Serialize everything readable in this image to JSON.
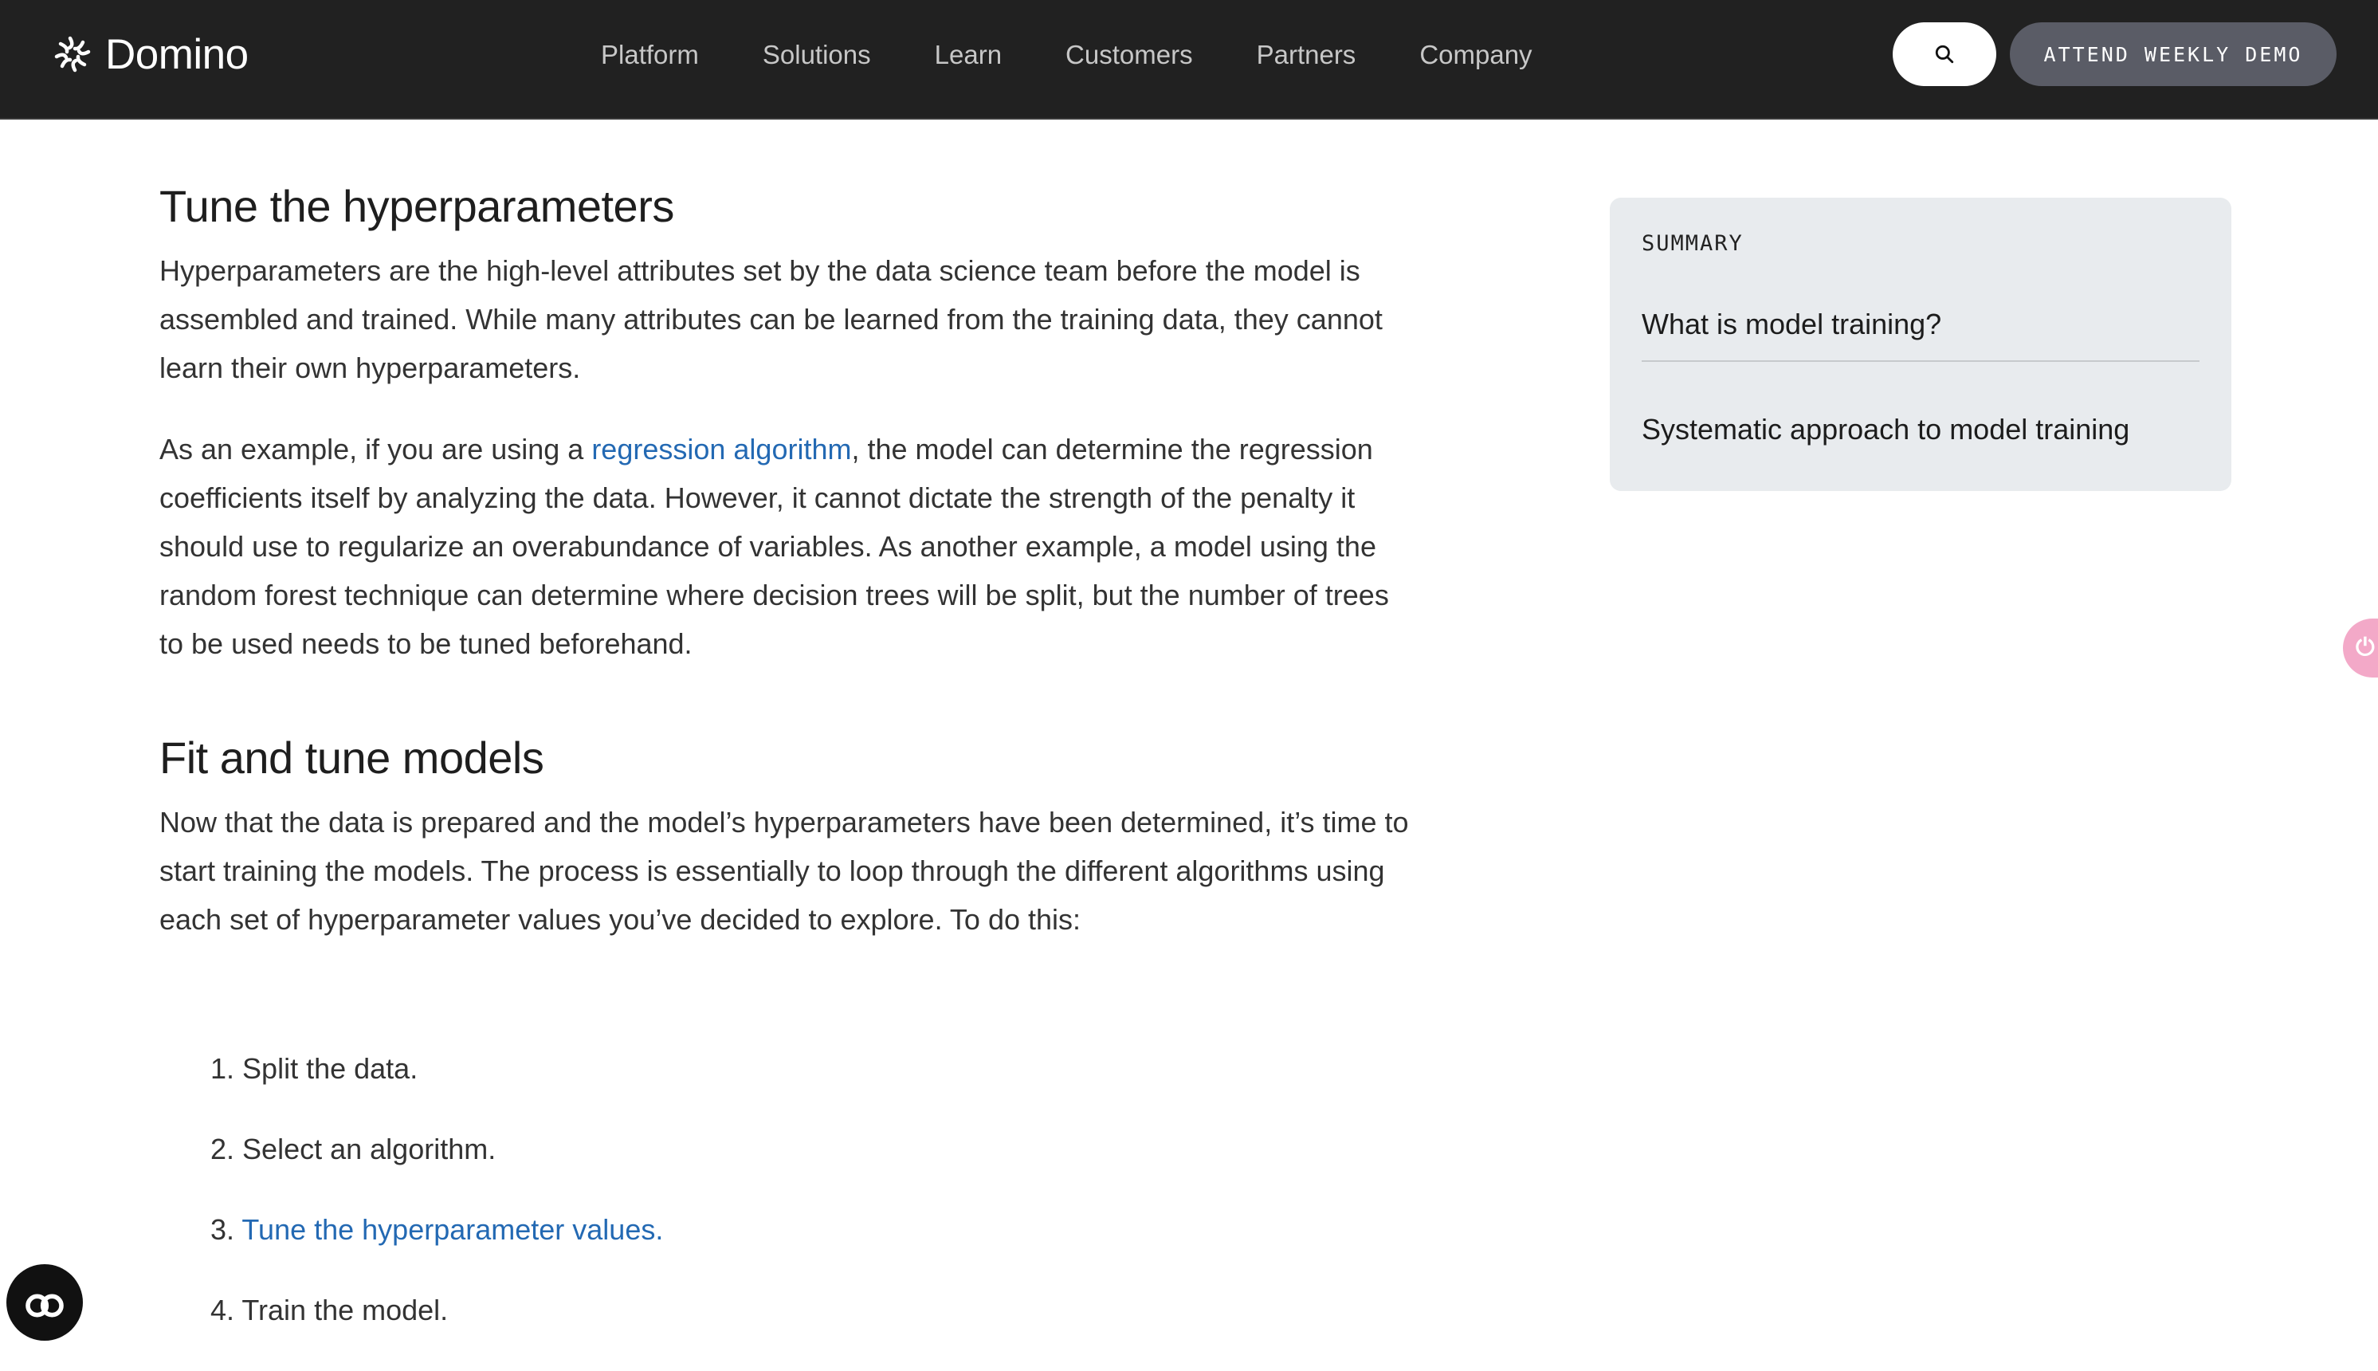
{
  "nav": {
    "brand": "Domino",
    "items": [
      "Platform",
      "Solutions",
      "Learn",
      "Customers",
      "Partners",
      "Company"
    ],
    "search_icon": "search-icon",
    "demo_button": "ATTEND WEEKLY DEMO"
  },
  "article": {
    "section1": {
      "title": "Tune the hyperparameters",
      "para1": "Hyperparameters are the high-level attributes set by the data science team before the model is assembled and trained. While many attributes can be learned from the training data, they cannot learn their own hyperparameters.",
      "para2_before": "As an example, if you are using a ",
      "para2_link": "regression algorithm",
      "para2_after": ", the model can determine the regression coefficients itself by analyzing the data. However, it cannot dictate the strength of the penalty it should use to regularize an overabundance of variables. As another example, a model using the random forest technique can determine where decision trees will be split, but the number of trees to be used needs to be tuned beforehand."
    },
    "section2": {
      "title": "Fit and tune models",
      "para1": "Now that the data is prepared and the model’s hyperparameters have been determined, it’s time to start training the models. The process is essentially to loop through the different algorithms using each set of hyperparameter values you’ve decided to explore. To do this:"
    },
    "steps": [
      {
        "num": "1.",
        "text": "Split the data."
      },
      {
        "num": "2.",
        "text": "Select an algorithm."
      },
      {
        "num": "3.",
        "text": "Tune the hyperparameter values."
      },
      {
        "num": "4.",
        "text": "Train the model."
      }
    ]
  },
  "summary": {
    "heading": "SUMMARY",
    "links": [
      "What is model training?",
      "Systematic approach to model training"
    ]
  },
  "colors": {
    "nav_bg": "#212121",
    "link": "#2369b3",
    "summary_bg": "#e8ebee",
    "demo_button_bg": "#5a5c66"
  }
}
